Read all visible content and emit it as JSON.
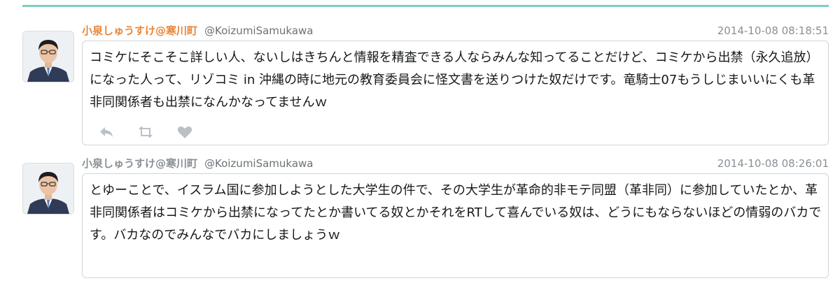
{
  "colors": {
    "accent_rule": "#7ccfc0",
    "display_name_first": "#e8863a",
    "display_name_second": "#8a8f94",
    "icon_gray": "#b9c0c6"
  },
  "tweets": [
    {
      "display_name": "小泉しゅうすけ@寒川町",
      "screen_name": "@KoizumiSamukawa",
      "timestamp": "2014-10-08 08:18:51",
      "text": "コミケにそこそこ詳しい人、ないしはきちんと情報を精査できる人ならみんな知ってることだけど、コミケから出禁（永久追放）になった人って、リゾコミ in 沖縄の時に地元の教育委員会に怪文書を送りつけた奴だけです。竜騎士07もうしじまいいにくも革非同関係者も出禁になんかなってませんｗ",
      "actions": [
        "reply-icon",
        "retweet-icon",
        "heart-icon"
      ]
    },
    {
      "display_name": "小泉しゅうすけ@寒川町",
      "screen_name": "@KoizumiSamukawa",
      "timestamp": "2014-10-08 08:26:01",
      "text": "とゆーことで、イスラム国に参加しようとした大学生の件で、その大学生が革命的非モテ同盟（革非同）に参加していたとか、革非同関係者はコミケから出禁になってたとか書いてる奴とかそれをRTして喜んでいる奴は、どうにもならないほどの情弱のバカです。バカなのでみんなでバカにしましょうｗ"
    }
  ]
}
